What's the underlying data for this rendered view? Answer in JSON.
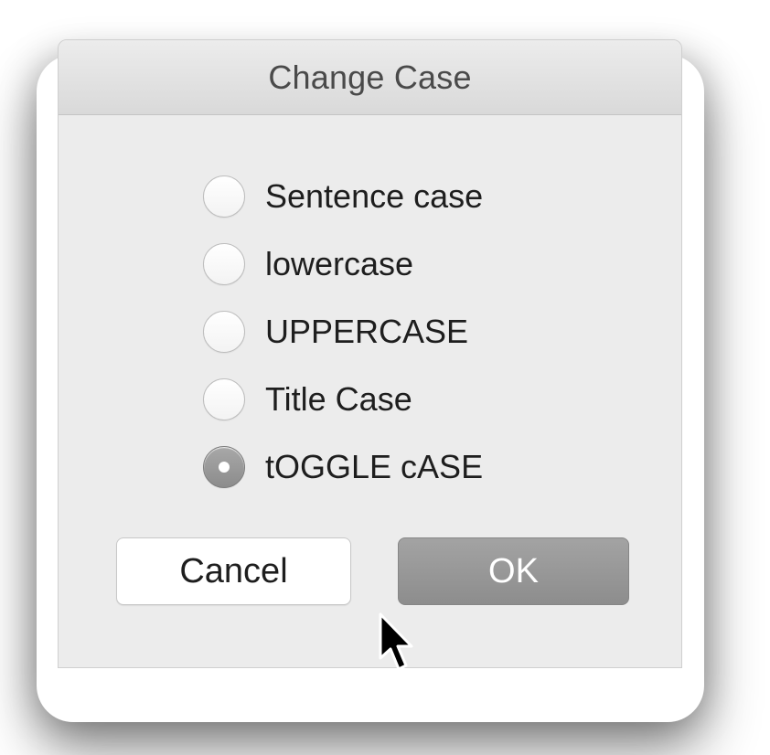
{
  "dialog": {
    "title": "Change Case",
    "options": [
      {
        "label": "Sentence case",
        "selected": false
      },
      {
        "label": "lowercase",
        "selected": false
      },
      {
        "label": "UPPERCASE",
        "selected": false
      },
      {
        "label": "Title Case",
        "selected": false
      },
      {
        "label": "tOGGLE cASE",
        "selected": true
      }
    ],
    "buttons": {
      "cancel_label": "Cancel",
      "ok_label": "OK"
    }
  },
  "icons": {
    "cursor": "arrow-cursor-icon"
  },
  "colors": {
    "dialog_background": "#ececec",
    "selected_radio": "#8c8c8c",
    "ok_button": "#999999"
  }
}
